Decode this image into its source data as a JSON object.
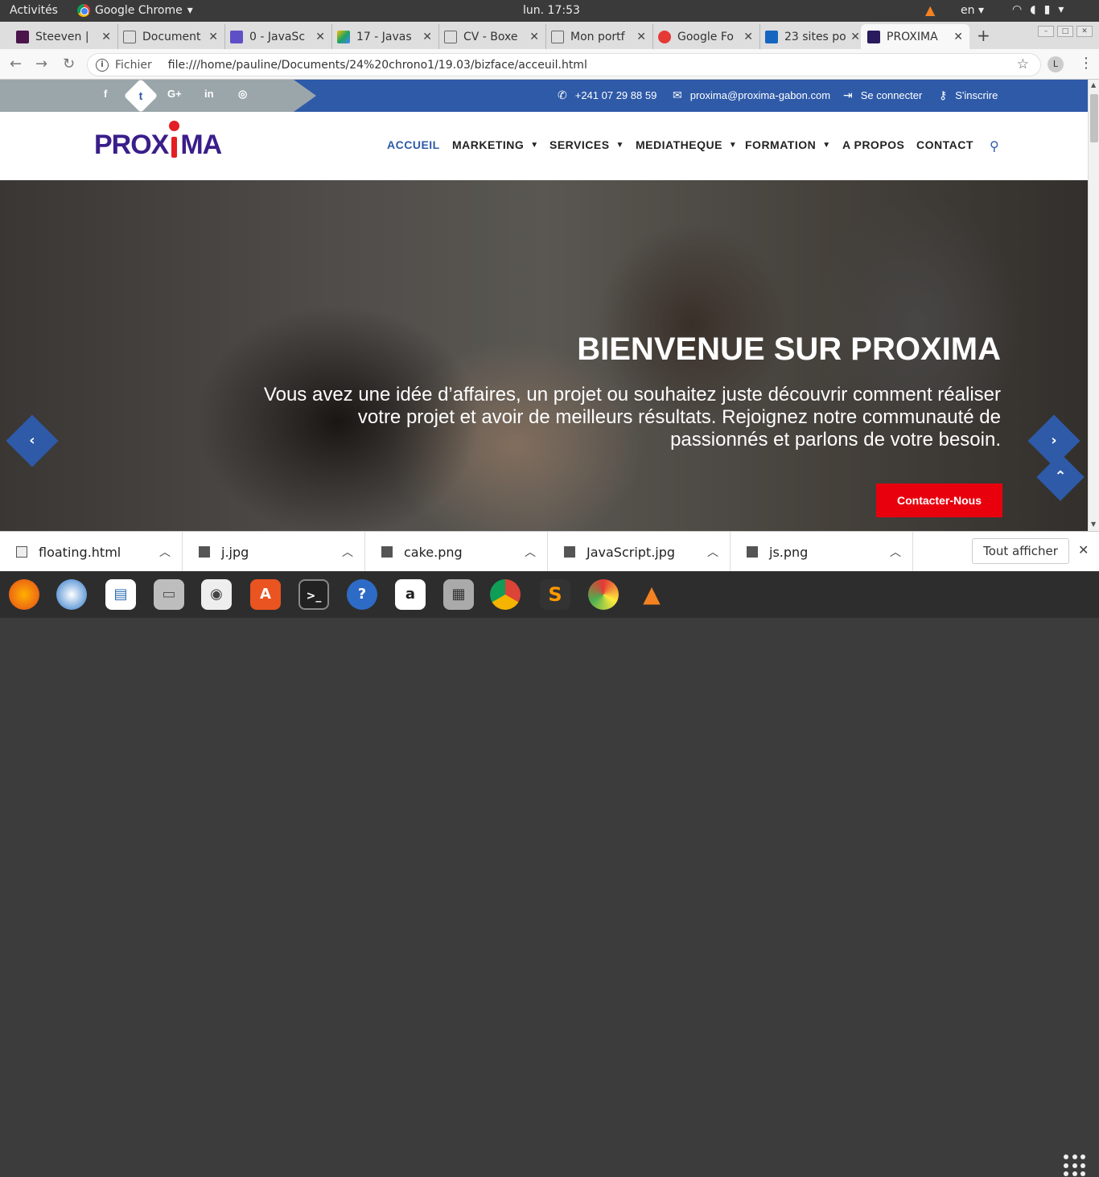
{
  "gnome": {
    "activities": "Activités",
    "app_name": "Google Chrome",
    "clock": "lun. 17:53",
    "lang": "en"
  },
  "tabs": [
    {
      "title": "Steeven |",
      "fav_color": "#4a154b"
    },
    {
      "title": "Document",
      "fav_color": "#ffffff"
    },
    {
      "title": "0 - JavaSc",
      "fav_color": "#5f4fc7"
    },
    {
      "title": "17 - Javas",
      "fav_color": "#1ea362"
    },
    {
      "title": "CV - Boxe",
      "fav_color": "#ffffff"
    },
    {
      "title": "Mon portf",
      "fav_color": "#ffffff"
    },
    {
      "title": "Google Fo",
      "fav_color": "#e53935"
    },
    {
      "title": "23 sites po",
      "fav_color": "#1565c0"
    },
    {
      "title": "PROXIMA",
      "fav_color": "#2a1a5e"
    }
  ],
  "address": {
    "security_label": "Fichier",
    "url": "file:///home/pauline/Documents/24%20chrono1/19.03/bizface/acceuil.html",
    "avatar": "L"
  },
  "topbar": {
    "social": [
      "f",
      "t",
      "G+",
      "in",
      "◎"
    ],
    "phone": "+241 07 29 88 59",
    "email": "proxima@proxima-gabon.com",
    "login": "Se connecter",
    "register": "S'inscrire"
  },
  "brand": {
    "part1": "PROX",
    "part2": "MA"
  },
  "nav": [
    "ACCUEIL",
    "MARKETING",
    "SERVICES",
    "MEDIATHEQUE",
    "FORMATION",
    "A PROPOS",
    "CONTACT"
  ],
  "hero": {
    "title": "BIENVENUE SUR PROXIMA",
    "text": "Vous avez une idée d’affaires, un projet ou souhaitez juste découvrir comment réaliser votre projet et avoir de meilleurs résultats. Rejoignez notre communauté de passionnés et parlons de votre besoin.",
    "cta": "Contacter-Nous"
  },
  "downloads": [
    "floating.html",
    "j.jpg",
    "cake.png",
    "JavaScript.jpg",
    "js.png"
  ],
  "downloads_show_all": "Tout afficher",
  "colors": {
    "brand_blue": "#2e5aa8",
    "cta_red": "#e8000d",
    "logo_purple": "#3a1e8a"
  }
}
